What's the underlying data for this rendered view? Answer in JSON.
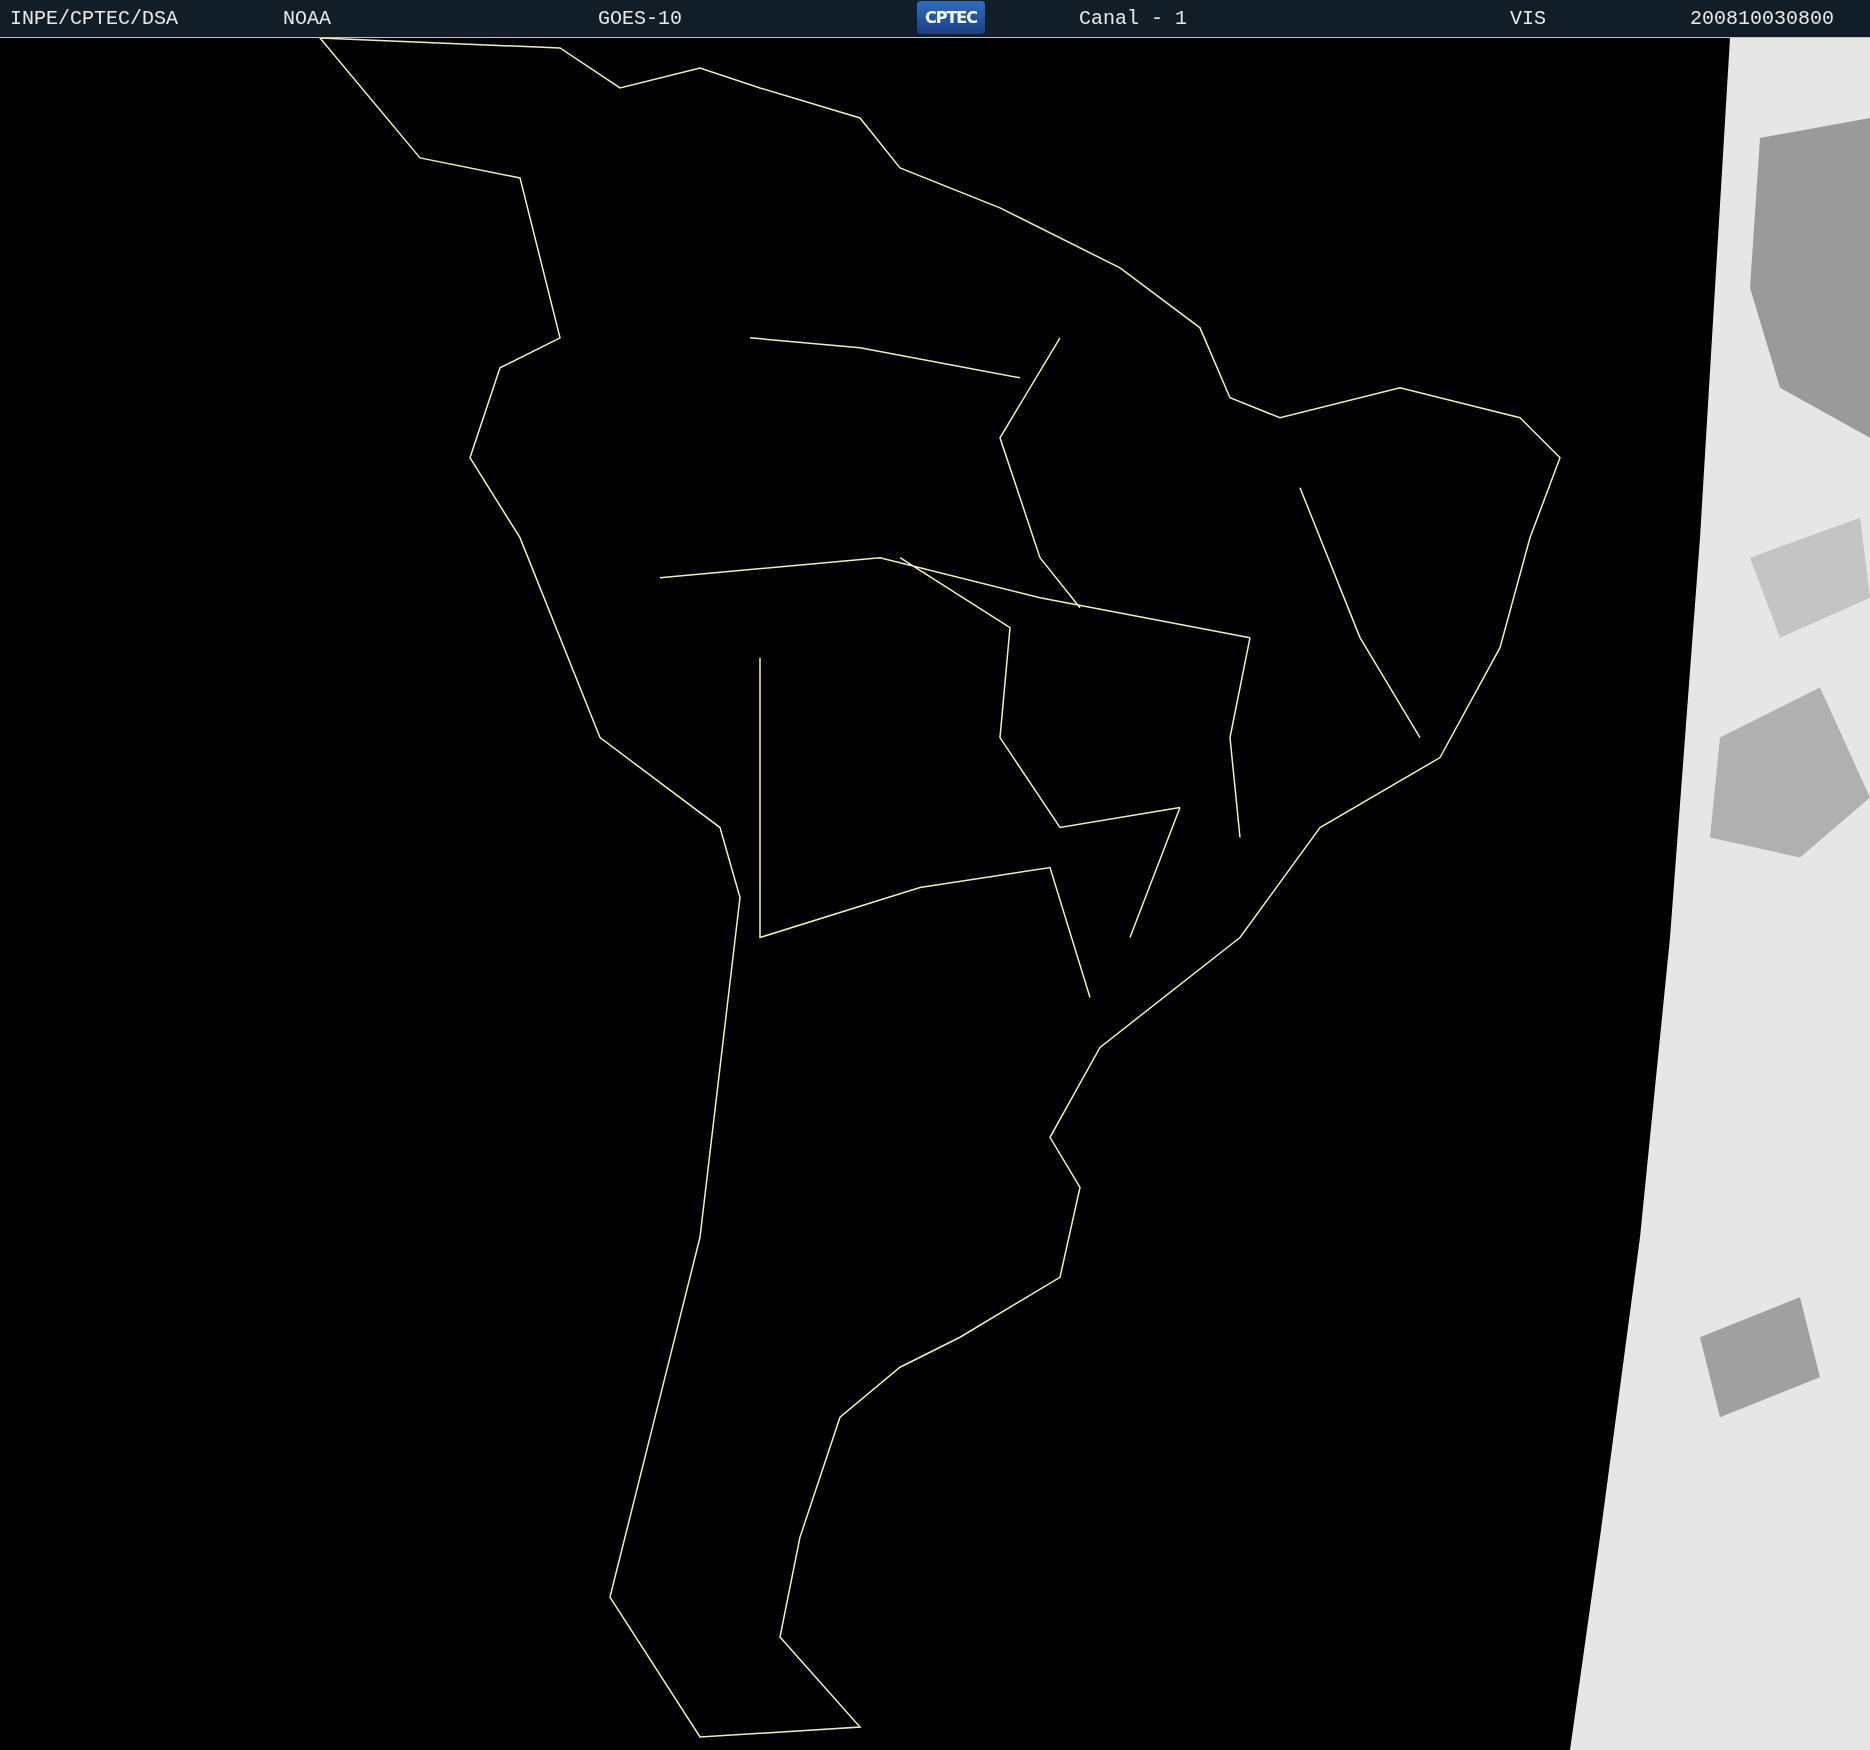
{
  "header": {
    "items": [
      {
        "kind": "text",
        "text": "INPE/CPTEC/DSA"
      },
      {
        "kind": "text",
        "text": "NOAA"
      },
      {
        "kind": "text",
        "text": "GOES-10"
      },
      {
        "kind": "logo",
        "text": "CPTEC"
      },
      {
        "kind": "text",
        "text": "Canal - 1"
      },
      {
        "kind": "text",
        "text": "VIS"
      },
      {
        "kind": "text",
        "text": "200810030800"
      }
    ]
  }
}
